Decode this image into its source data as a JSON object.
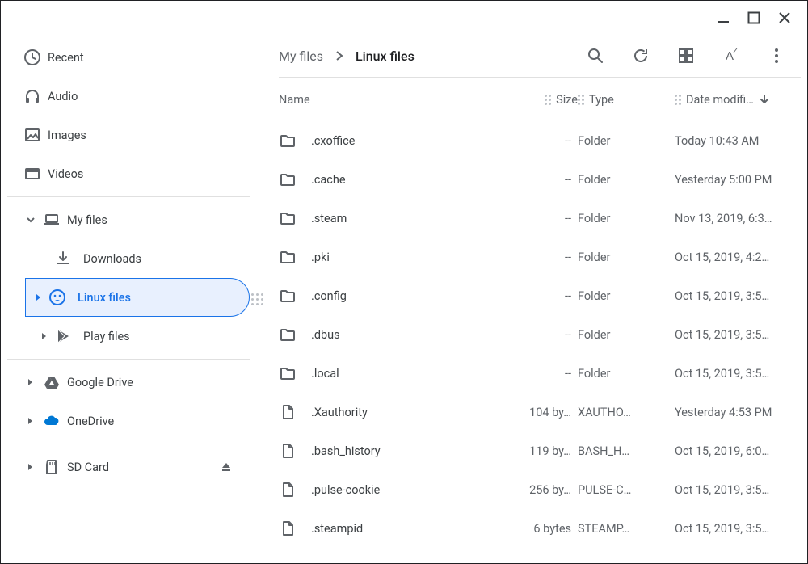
{
  "breadcrumb": {
    "parent": "My files",
    "current": "Linux files"
  },
  "columns": {
    "name": "Name",
    "size": "Size",
    "type": "Type",
    "date": "Date modifi…"
  },
  "sidebar": {
    "recent": "Recent",
    "audio": "Audio",
    "images": "Images",
    "videos": "Videos",
    "myfiles": "My files",
    "downloads": "Downloads",
    "linux": "Linux files",
    "play": "Play files",
    "gdrive": "Google Drive",
    "onedrive": "OneDrive",
    "sdcard": "SD Card"
  },
  "rows": [
    {
      "icon": "folder",
      "name": ".cxoffice",
      "size": "--",
      "type": "Folder",
      "date": "Today 10:43 AM"
    },
    {
      "icon": "folder",
      "name": ".cache",
      "size": "--",
      "type": "Folder",
      "date": "Yesterday 5:00 PM"
    },
    {
      "icon": "folder",
      "name": ".steam",
      "size": "--",
      "type": "Folder",
      "date": "Nov 13, 2019, 6:3…"
    },
    {
      "icon": "folder",
      "name": ".pki",
      "size": "--",
      "type": "Folder",
      "date": "Oct 15, 2019, 4:2…"
    },
    {
      "icon": "folder",
      "name": ".config",
      "size": "--",
      "type": "Folder",
      "date": "Oct 15, 2019, 3:5…"
    },
    {
      "icon": "folder",
      "name": ".dbus",
      "size": "--",
      "type": "Folder",
      "date": "Oct 15, 2019, 3:5…"
    },
    {
      "icon": "folder",
      "name": ".local",
      "size": "--",
      "type": "Folder",
      "date": "Oct 15, 2019, 3:5…"
    },
    {
      "icon": "file",
      "name": ".Xauthority",
      "size": "104 by…",
      "type": "XAUTHO…",
      "date": "Yesterday 4:53 PM"
    },
    {
      "icon": "file",
      "name": ".bash_history",
      "size": "119 by…",
      "type": "BASH_H…",
      "date": "Oct 15, 2019, 6:0…"
    },
    {
      "icon": "file",
      "name": ".pulse-cookie",
      "size": "256 by…",
      "type": "PULSE-C…",
      "date": "Oct 15, 2019, 3:5…"
    },
    {
      "icon": "file",
      "name": ".steampid",
      "size": "6 bytes",
      "type": "STEAMP…",
      "date": "Oct 15, 2019, 3:5…"
    }
  ]
}
